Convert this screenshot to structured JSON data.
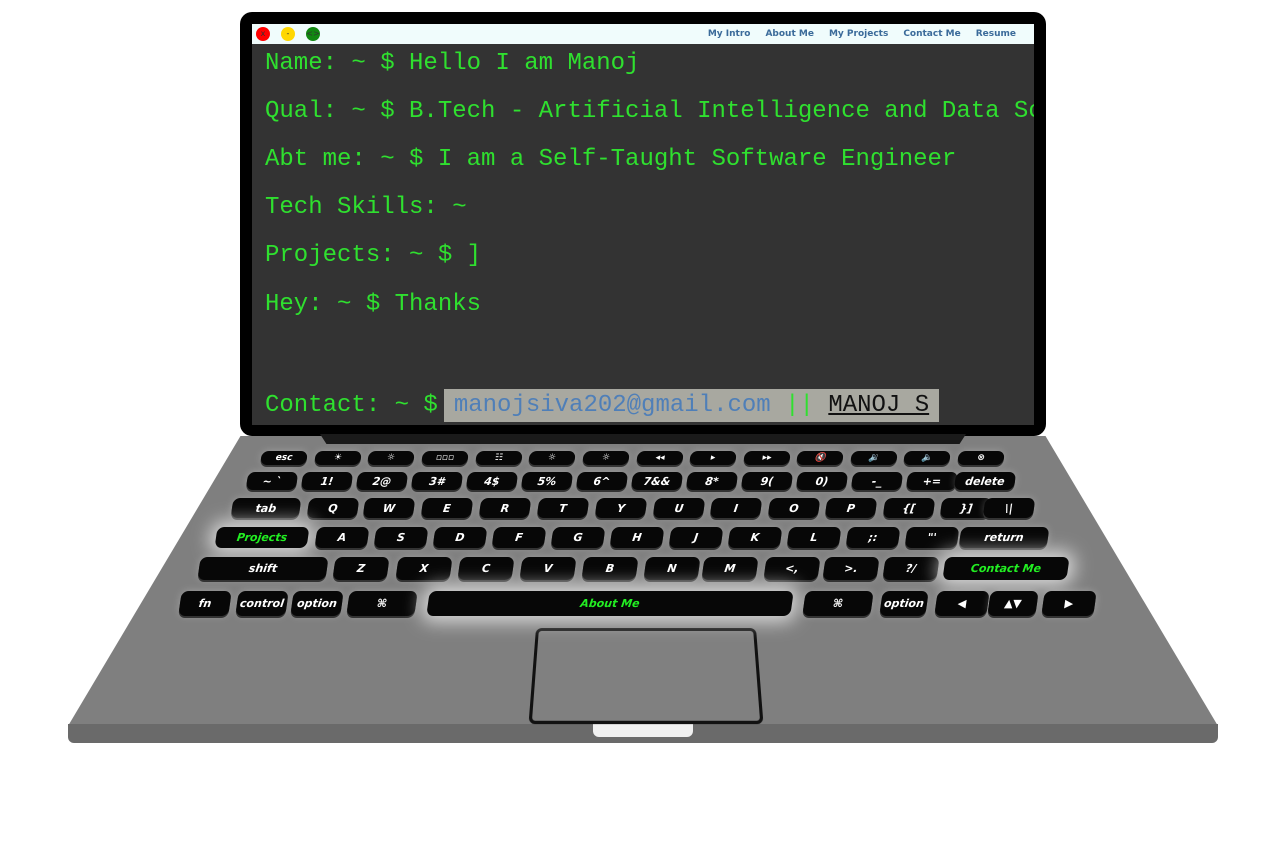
{
  "window": {
    "close": "x",
    "minimize": "-",
    "maximize": "<>"
  },
  "nav": [
    "My Intro",
    "About Me",
    "My Projects",
    "Contact Me",
    "Resume"
  ],
  "terminal": {
    "line1": "Name: ~ $ Hello I am Manoj",
    "line2": "Qual: ~ $ B.Tech - Artificial Intelligence and Data Science",
    "line3": "Abt me: ~ $ I am a Self-Taught Software Engineer",
    "line4": "Tech Skills: ~ $",
    "line5": "Projects: ~ $ ]",
    "line6": "Hey: ~ $ Thanks",
    "contact_prompt": "Contact: ~ $",
    "email": "manojsiva202@gmail.com",
    "separator": "||",
    "name_link": "MANOJ S"
  },
  "keyboard": {
    "row_fn": [
      "esc",
      "☀",
      "☼",
      "▫▫▫",
      "☷",
      "☼",
      "☼",
      "◂◂",
      "▸",
      "▸▸",
      "🔇",
      "🔉",
      "🔈",
      "⊗"
    ],
    "row_num": [
      "~ `",
      "1!",
      "2@",
      "3#",
      "4$",
      "5%",
      "6^",
      "7&&",
      "8*",
      "9(",
      "0)",
      "-_",
      "+=",
      "delete"
    ],
    "row_q": [
      "tab",
      "Q",
      "W",
      "E",
      "R",
      "T",
      "Y",
      "U",
      "I",
      "O",
      "P",
      "{[",
      "}]",
      "\\|"
    ],
    "row_a": [
      "Projects",
      "A",
      "S",
      "D",
      "F",
      "G",
      "H",
      "J",
      "K",
      "L",
      ";:",
      "\"'",
      "return"
    ],
    "row_z": [
      "shift",
      "Z",
      "X",
      "C",
      "V",
      "B",
      "N",
      "M",
      "<,",
      ">.",
      "?/",
      "Contact Me"
    ],
    "row_bottom": [
      "fn",
      "control",
      "option",
      "⌘",
      "About Me",
      "⌘",
      "option",
      "◀",
      "▲▼",
      "▶"
    ]
  }
}
